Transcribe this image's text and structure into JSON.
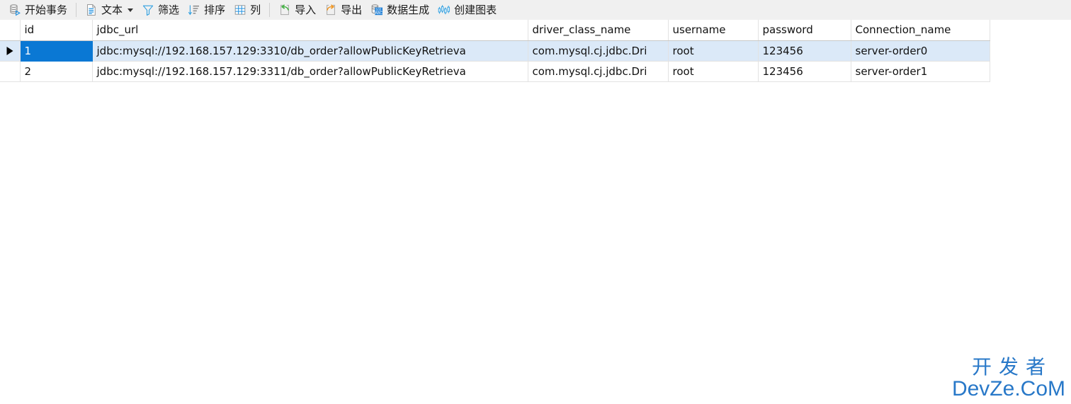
{
  "toolbar": {
    "items": [
      {
        "id": "begin-transaction",
        "label": "开始事务",
        "icon": "database-play-icon",
        "has_caret": false
      },
      {
        "id": "text",
        "label": "文本",
        "icon": "document-text-icon",
        "has_caret": true
      },
      {
        "id": "filter",
        "label": "筛选",
        "icon": "funnel-icon",
        "has_caret": false
      },
      {
        "id": "sort",
        "label": "排序",
        "icon": "sort-descending-icon",
        "has_caret": false
      },
      {
        "id": "columns",
        "label": "列",
        "icon": "grid-table-icon",
        "has_caret": false
      },
      {
        "id": "import",
        "label": "导入",
        "icon": "import-arrow-icon",
        "has_caret": false
      },
      {
        "id": "export",
        "label": "导出",
        "icon": "export-arrow-icon",
        "has_caret": false
      },
      {
        "id": "data-generation",
        "label": "数据生成",
        "icon": "database-101abc-icon",
        "has_caret": false
      },
      {
        "id": "create-chart",
        "label": "创建图表",
        "icon": "candlestick-chart-icon",
        "has_caret": false
      }
    ],
    "separators_after": [
      "begin-transaction",
      "columns"
    ]
  },
  "grid": {
    "columns": [
      {
        "key": "id",
        "label": "id"
      },
      {
        "key": "jdbc_url",
        "label": "jdbc_url"
      },
      {
        "key": "driver_class_name",
        "label": "driver_class_name"
      },
      {
        "key": "username",
        "label": "username"
      },
      {
        "key": "password",
        "label": "password"
      },
      {
        "key": "Connection_name",
        "label": "Connection_name"
      }
    ],
    "rows": [
      {
        "id": "1",
        "jdbc_url": "jdbc:mysql://192.168.157.129:3310/db_order?allowPublicKeyRetrieva",
        "driver_class_name": "com.mysql.cj.jdbc.Dri",
        "username": "root",
        "password": "123456",
        "Connection_name": "server-order0",
        "selected": true,
        "marker": "▶"
      },
      {
        "id": "2",
        "jdbc_url": "jdbc:mysql://192.168.157.129:3311/db_order?allowPublicKeyRetrieva",
        "driver_class_name": "com.mysql.cj.jdbc.Dri",
        "username": "root",
        "password": "123456",
        "Connection_name": "server-order1",
        "selected": false,
        "marker": ""
      }
    ],
    "active_cell": {
      "row": 0,
      "column": "id"
    }
  },
  "watermark": {
    "chinese": "开发者",
    "latin": "DevZe.CoM"
  },
  "colors": {
    "toolbar_bg": "#f0f0f0",
    "selection_blue": "#0a78d4",
    "row_highlight": "#dbe9f8",
    "header_id_bg": "#dce9f7",
    "accent_icon_blue": "#1e90e0",
    "watermark_blue": "#2878c8"
  }
}
